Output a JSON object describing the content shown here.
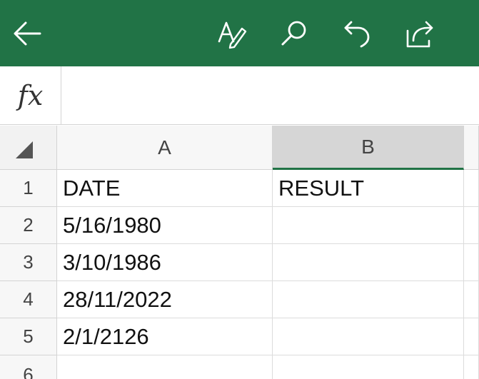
{
  "colors": {
    "toolbar": "#217346",
    "selected_header": "#d6d6d6",
    "accent": "#217346"
  },
  "toolbar": {
    "back_icon": "arrow-left-icon",
    "format_icon": "text-format-pen-icon",
    "search_icon": "search-icon",
    "undo_icon": "undo-icon",
    "share_icon": "share-icon"
  },
  "formula_bar": {
    "label": "fx",
    "value": ""
  },
  "sheet": {
    "columns": [
      "A",
      "B"
    ],
    "selected_column": "B",
    "rows": [
      {
        "num": "1",
        "A": "DATE",
        "B": "RESULT"
      },
      {
        "num": "2",
        "A": "5/16/1980",
        "B": ""
      },
      {
        "num": "3",
        "A": "3/10/1986",
        "B": ""
      },
      {
        "num": "4",
        "A": "28/11/2022",
        "B": ""
      },
      {
        "num": "5",
        "A": "2/1/2126",
        "B": ""
      },
      {
        "num": "6",
        "A": "",
        "B": ""
      }
    ]
  }
}
